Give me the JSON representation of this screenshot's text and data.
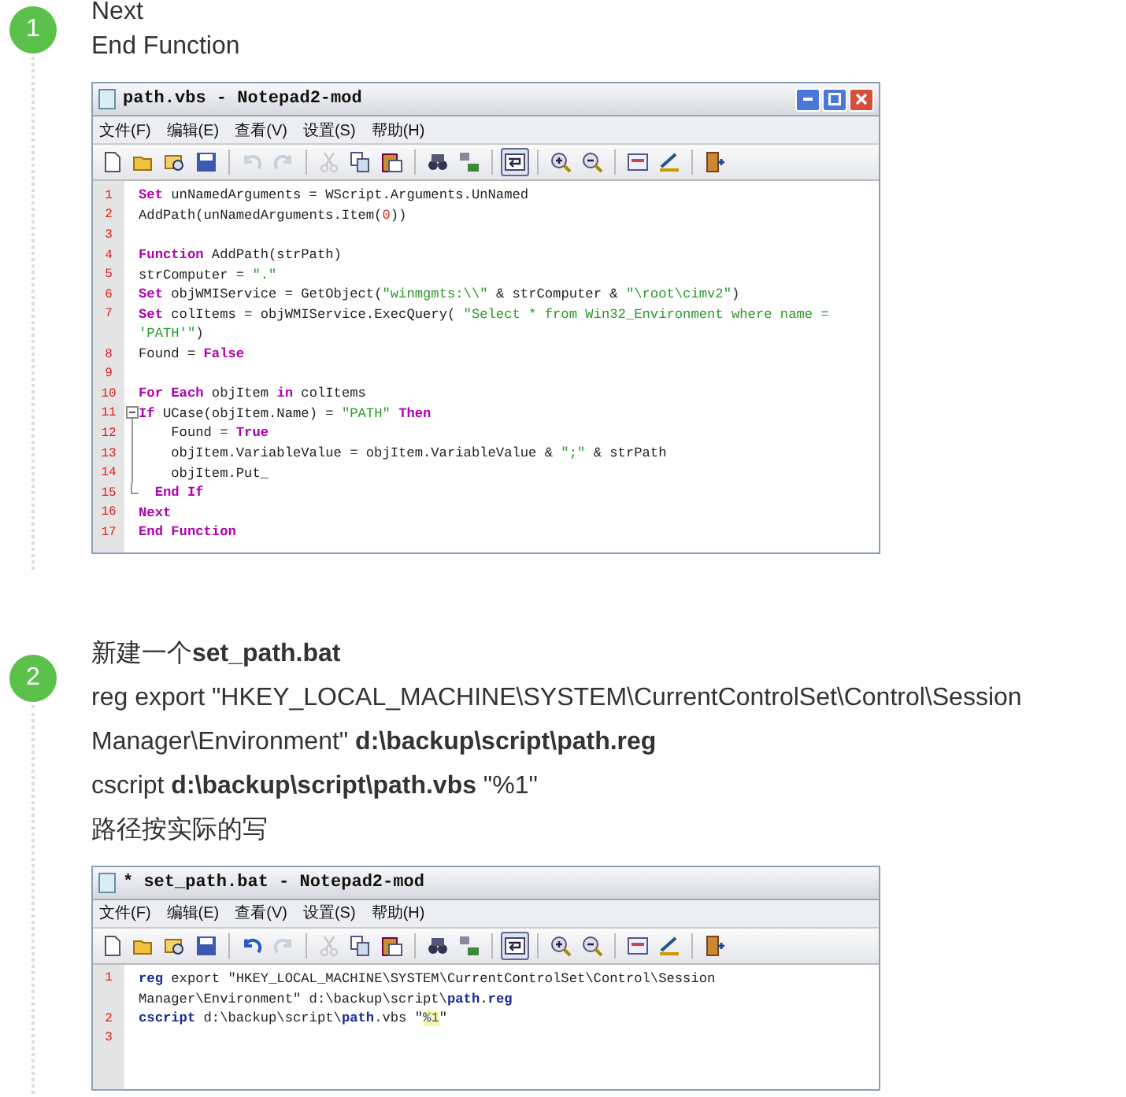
{
  "steps": [
    {
      "number": "1",
      "paragraphs": [
        "Next",
        "End Function"
      ],
      "editor": {
        "title": "path.vbs - Notepad2-mod",
        "window_buttons": [
          {
            "kind": "minimize"
          },
          {
            "kind": "maximize"
          },
          {
            "kind": "close"
          }
        ],
        "menu": [
          "文件(F)",
          "编辑(E)",
          "查看(V)",
          "设置(S)",
          "帮助(H)"
        ],
        "toolbar": [
          {
            "kind": "new"
          },
          {
            "kind": "open"
          },
          {
            "kind": "browse"
          },
          {
            "kind": "save"
          },
          {
            "kind": "separator"
          },
          {
            "kind": "undo",
            "disabled": true
          },
          {
            "kind": "redo",
            "disabled": true
          },
          {
            "kind": "separator"
          },
          {
            "kind": "cut",
            "disabled": true
          },
          {
            "kind": "copy"
          },
          {
            "kind": "paste"
          },
          {
            "kind": "separator"
          },
          {
            "kind": "find"
          },
          {
            "kind": "replace"
          },
          {
            "kind": "separator"
          },
          {
            "kind": "wrap",
            "pressed": true
          },
          {
            "kind": "separator"
          },
          {
            "kind": "zoom-in"
          },
          {
            "kind": "zoom-out"
          },
          {
            "kind": "separator"
          },
          {
            "kind": "scheme"
          },
          {
            "kind": "customize"
          },
          {
            "kind": "separator"
          },
          {
            "kind": "exit"
          }
        ],
        "lines": [
          {
            "number": "1",
            "rows": [
              [
                {
                  "kind": "keyword",
                  "text": "Set"
                },
                {
                  "kind": "plain",
                  "text": " unNamedArguments = WScript.Arguments.UnNamed"
                }
              ]
            ]
          },
          {
            "number": "2",
            "rows": [
              [
                {
                  "kind": "plain",
                  "text": "AddPath(unNamedArguments.Item("
                },
                {
                  "kind": "number",
                  "text": "0"
                },
                {
                  "kind": "plain",
                  "text": "))"
                }
              ]
            ]
          },
          {
            "number": "3",
            "rows": [
              []
            ]
          },
          {
            "number": "4",
            "rows": [
              [
                {
                  "kind": "keyword",
                  "text": "Function"
                },
                {
                  "kind": "plain",
                  "text": " AddPath(strPath)"
                }
              ]
            ]
          },
          {
            "number": "5",
            "rows": [
              [
                {
                  "kind": "plain",
                  "text": "strComputer = "
                },
                {
                  "kind": "string",
                  "text": "\".\""
                }
              ]
            ]
          },
          {
            "number": "6",
            "rows": [
              [
                {
                  "kind": "keyword",
                  "text": "Set"
                },
                {
                  "kind": "plain",
                  "text": " objWMIService = GetObject("
                },
                {
                  "kind": "string",
                  "text": "\"winmgmts:\\\\\""
                },
                {
                  "kind": "plain",
                  "text": " & strComputer & "
                },
                {
                  "kind": "string",
                  "text": "\"\\root\\cimv2\""
                },
                {
                  "kind": "plain",
                  "text": ")"
                }
              ]
            ]
          },
          {
            "number": "7",
            "rows": [
              [
                {
                  "kind": "keyword",
                  "text": "Set"
                },
                {
                  "kind": "plain",
                  "text": " colItems = objWMIService.ExecQuery( "
                },
                {
                  "kind": "string",
                  "text": "\"Select * from Win32_Environment where name ="
                }
              ],
              [
                {
                  "kind": "string",
                  "text": "'PATH'\""
                },
                {
                  "kind": "plain",
                  "text": ")"
                }
              ]
            ]
          },
          {
            "number": "8",
            "rows": [
              [
                {
                  "kind": "plain",
                  "text": "Found = "
                },
                {
                  "kind": "keyword",
                  "text": "False"
                }
              ]
            ]
          },
          {
            "number": "9",
            "rows": [
              []
            ]
          },
          {
            "number": "10",
            "rows": [
              [
                {
                  "kind": "keyword",
                  "text": "For Each"
                },
                {
                  "kind": "plain",
                  "text": " objItem "
                },
                {
                  "kind": "keyword",
                  "text": "in"
                },
                {
                  "kind": "plain",
                  "text": " colItems"
                }
              ]
            ]
          },
          {
            "number": "11",
            "kind": "foldstart",
            "rows": [
              [
                {
                  "kind": "keyword",
                  "text": "If"
                },
                {
                  "kind": "plain",
                  "text": " UCase(objItem.Name) = "
                },
                {
                  "kind": "string",
                  "text": "\"PATH\""
                },
                {
                  "kind": "plain",
                  "text": " "
                },
                {
                  "kind": "keyword",
                  "text": "Then"
                }
              ]
            ]
          },
          {
            "number": "12",
            "kind": "foldbody",
            "rows": [
              [
                {
                  "kind": "plain",
                  "text": "    Found = "
                },
                {
                  "kind": "keyword",
                  "text": "True"
                }
              ]
            ]
          },
          {
            "number": "13",
            "kind": "foldbody",
            "rows": [
              [
                {
                  "kind": "plain",
                  "text": "    objItem.VariableValue = objItem.VariableValue & "
                },
                {
                  "kind": "string",
                  "text": "\";\""
                },
                {
                  "kind": "plain",
                  "text": " & strPath"
                }
              ]
            ]
          },
          {
            "number": "14",
            "kind": "foldbody",
            "rows": [
              [
                {
                  "kind": "plain",
                  "text": "    objItem.Put_"
                }
              ]
            ]
          },
          {
            "number": "15",
            "kind": "foldend",
            "rows": [
              [
                {
                  "kind": "plain",
                  "text": "  "
                },
                {
                  "kind": "keyword",
                  "text": "End If"
                }
              ]
            ]
          },
          {
            "number": "16",
            "rows": [
              [
                {
                  "kind": "keyword",
                  "text": "Next"
                }
              ]
            ]
          },
          {
            "number": "17",
            "rows": [
              [
                {
                  "kind": "keyword",
                  "text": "End Function"
                }
              ]
            ]
          }
        ]
      }
    },
    {
      "number": "2",
      "paragraphs": [
        "新建一个**set_path.bat**",
        "reg  export  \"HKEY_LOCAL_MACHINE\\SYSTEM\\CurrentControlSet\\Control\\Session Manager\\Environment\" **d:\\backup\\script\\path.reg**",
        "cscript **d:\\backup\\script\\path.vbs** \"%1\"",
        "路径按实际的写"
      ],
      "editor": {
        "title": "* set_path.bat - Notepad2-mod",
        "menu": [
          "文件(F)",
          "编辑(E)",
          "查看(V)",
          "设置(S)",
          "帮助(H)"
        ],
        "toolbar": [
          {
            "kind": "new"
          },
          {
            "kind": "open"
          },
          {
            "kind": "browse"
          },
          {
            "kind": "save"
          },
          {
            "kind": "separator"
          },
          {
            "kind": "undo"
          },
          {
            "kind": "redo",
            "disabled": true
          },
          {
            "kind": "separator"
          },
          {
            "kind": "cut",
            "disabled": true
          },
          {
            "kind": "copy"
          },
          {
            "kind": "paste"
          },
          {
            "kind": "separator"
          },
          {
            "kind": "find"
          },
          {
            "kind": "replace"
          },
          {
            "kind": "separator"
          },
          {
            "kind": "wrap",
            "pressed": true
          },
          {
            "kind": "separator"
          },
          {
            "kind": "zoom-in"
          },
          {
            "kind": "zoom-out"
          },
          {
            "kind": "separator"
          },
          {
            "kind": "scheme"
          },
          {
            "kind": "customize"
          },
          {
            "kind": "separator"
          },
          {
            "kind": "exit"
          }
        ],
        "lines": [
          {
            "number": "1",
            "rows": [
              [
                {
                  "kind": "command",
                  "text": "reg"
                },
                {
                  "kind": "plain",
                  "text": " export \"HKEY_LOCAL_MACHINE\\SYSTEM\\CurrentControlSet\\Control\\Session"
                }
              ],
              [
                {
                  "kind": "plain",
                  "text": "Manager\\Environment\" d:\\backup\\script\\"
                },
                {
                  "kind": "command",
                  "text": "path"
                },
                {
                  "kind": "plain",
                  "text": "."
                },
                {
                  "kind": "command",
                  "text": "reg"
                }
              ]
            ]
          },
          {
            "number": "2",
            "rows": [
              [
                {
                  "kind": "command",
                  "text": "cscript"
                },
                {
                  "kind": "plain",
                  "text": " d:\\backup\\script\\"
                },
                {
                  "kind": "command",
                  "text": "path"
                },
                {
                  "kind": "plain",
                  "text": ".vbs \""
                },
                {
                  "kind": "variable",
                  "text": "%1"
                },
                {
                  "kind": "plain",
                  "text": "\""
                }
              ]
            ]
          },
          {
            "number": "3",
            "rows": [
              []
            ]
          }
        ]
      }
    }
  ]
}
